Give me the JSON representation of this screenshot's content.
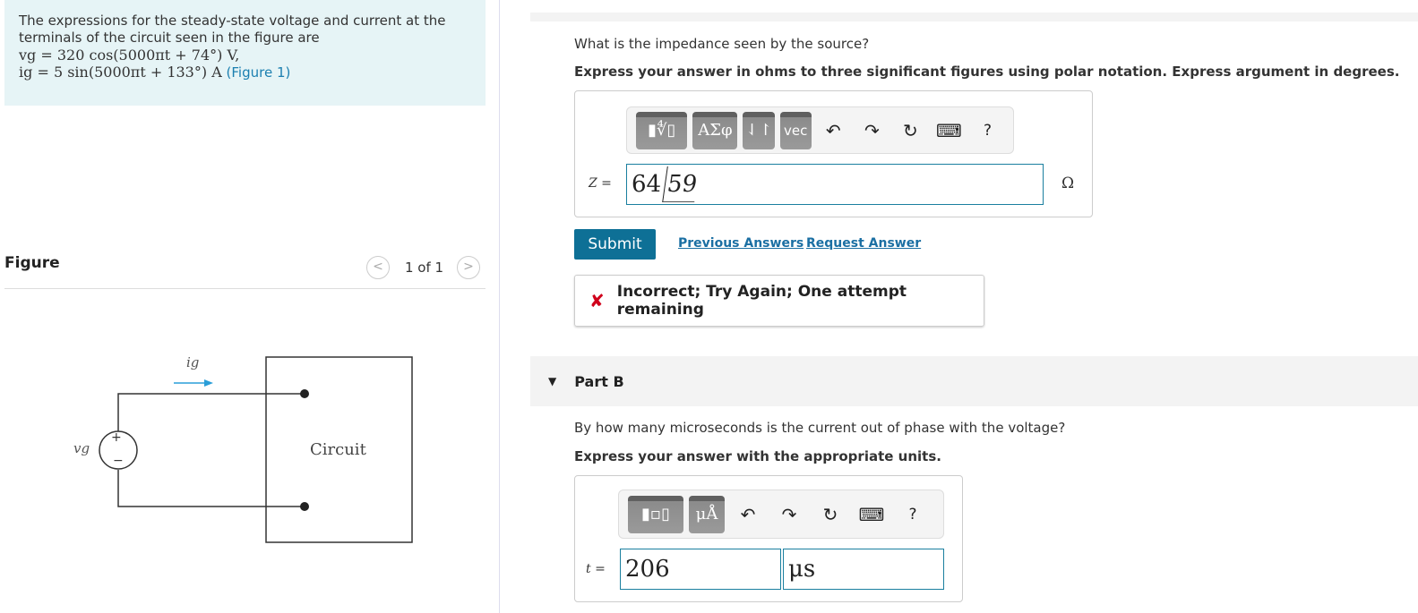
{
  "intro": {
    "text": "The expressions for the steady-state voltage and current at the terminals of the circuit seen in the figure are",
    "vg_eq": "vg = 320 cos(5000πt + 74°) V,",
    "ig_eq": "ig = 5 sin(5000πt + 133°) A",
    "figure_link": "(Figure 1)"
  },
  "figure": {
    "title": "Figure",
    "pager": "1 of 1",
    "prev": "<",
    "next": ">",
    "circuit_label": "Circuit",
    "current_label": "ig",
    "source_label": "vg",
    "plus": "+",
    "minus": "−"
  },
  "partA": {
    "question": "What is the impedance seen by the source?",
    "instruction": "Express your answer in ohms to three significant figures using polar notation. Express argument in degrees.",
    "toolbar": {
      "templates": "▮∜▯",
      "greek": "ΑΣφ",
      "arrows": "⇃↾",
      "vec": "vec",
      "undo": "↶",
      "redo": "↷",
      "reset": "↻",
      "keyboard": "⌨",
      "help": "?"
    },
    "label": "Z =",
    "magnitude": "64",
    "angle": "59",
    "unit": "Ω",
    "submit": "Submit",
    "previous_answers": "Previous Answers",
    "request_answer": "Request Answer",
    "feedback_icon": "✘",
    "feedback": "Incorrect; Try Again; One attempt remaining",
    "feedback_color": "#d0021b"
  },
  "partB": {
    "title": "Part B",
    "toggle": "▼",
    "question": "By how many microseconds is the current out of phase with the voltage?",
    "instruction": "Express your answer with the appropriate units.",
    "toolbar": {
      "templates": "▮▫▯",
      "units": "μÅ",
      "undo": "↶",
      "redo": "↷",
      "reset": "↻",
      "keyboard": "⌨",
      "help": "?"
    },
    "label": "t =",
    "value": "206",
    "unit": "μs"
  }
}
